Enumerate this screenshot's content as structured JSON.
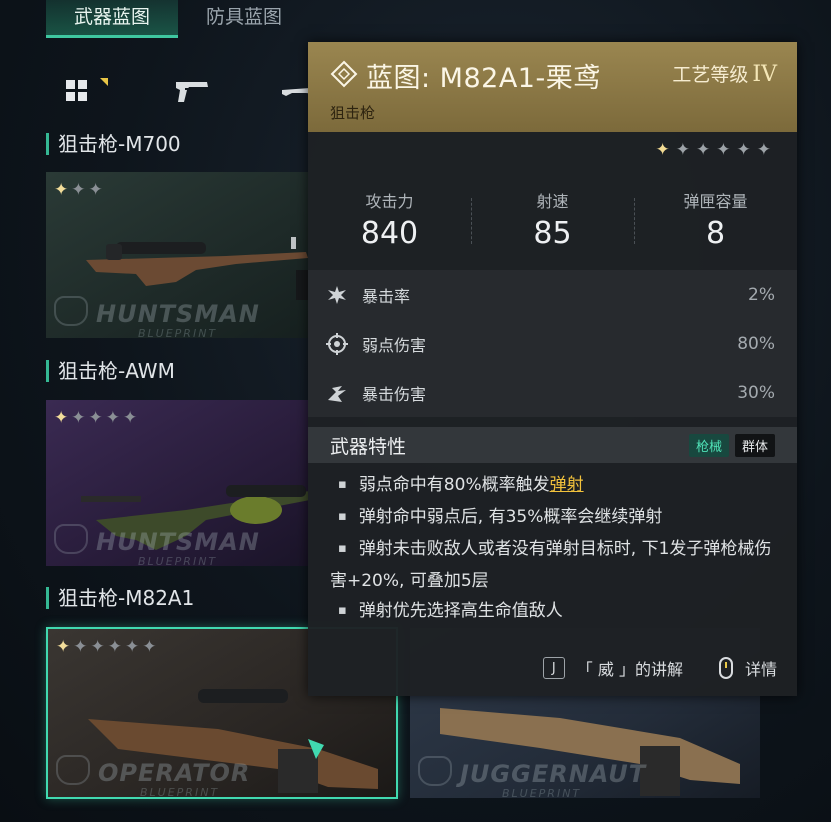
{
  "tabs": [
    {
      "label": "武器蓝图",
      "active": true
    },
    {
      "label": "防具蓝图",
      "active": false
    }
  ],
  "categories": [
    {
      "icon": "grid-icon",
      "active": true
    },
    {
      "icon": "pistol-icon",
      "active": false
    },
    {
      "icon": "rifle-icon",
      "active": false
    }
  ],
  "sections": [
    {
      "title": "狙击枪-M700",
      "card": {
        "stars_total": 3,
        "stars_lit": 1,
        "brand": "HUNTSMAN",
        "brand_sub": "BLUEPRINT"
      }
    },
    {
      "title": "狙击枪-AWM",
      "card": {
        "stars_total": 5,
        "stars_lit": 1,
        "brand": "HUNTSMAN",
        "brand_sub": "BLUEPRINT"
      }
    },
    {
      "title": "狙击枪-M82A1",
      "card": {
        "stars_total": 6,
        "stars_lit": 1,
        "brand": "OPERATOR",
        "brand_sub": "BLUEPRINT"
      }
    }
  ],
  "extra_card": {
    "brand": "JUGGERNAUT",
    "brand_sub": "BLUEPRINT"
  },
  "tooltip": {
    "title": "蓝图: M82A1-栗鸢",
    "grade_label": "工艺等级",
    "grade_value": "IV",
    "subtitle": "狙击枪",
    "stars_total": 6,
    "stars_lit": 1,
    "stats": [
      {
        "label": "攻击力",
        "value": "840"
      },
      {
        "label": "射速",
        "value": "85"
      },
      {
        "label": "弹匣容量",
        "value": "8"
      }
    ],
    "attrs": [
      {
        "icon": "crit-rate-icon",
        "label": "暴击率",
        "value": "2%"
      },
      {
        "icon": "weakspot-icon",
        "label": "弱点伤害",
        "value": "80%"
      },
      {
        "icon": "crit-damage-icon",
        "label": "暴击伤害",
        "value": "30%"
      }
    ],
    "feature_title": "武器特性",
    "tags": [
      "枪械",
      "群体"
    ],
    "features": {
      "f1_pre": "弱点命中有80%概率触发",
      "f1_link": "弹射",
      "f2": "弹射命中弱点后, 有35%概率会继续弹射",
      "f3": "弹射未击败敌人或者没有弹射目标时, 下1发子弹枪械伤害+20%, 可叠加5层",
      "f4": "弹射优先选择高生命值敌人"
    },
    "footer": {
      "key": "J",
      "explain": "「 威 」的讲解",
      "details": "详情"
    },
    "colors": {
      "header_gold": "#9a8650",
      "accent_teal": "#3fc7a0",
      "link_yellow": "#f2c23c"
    }
  }
}
